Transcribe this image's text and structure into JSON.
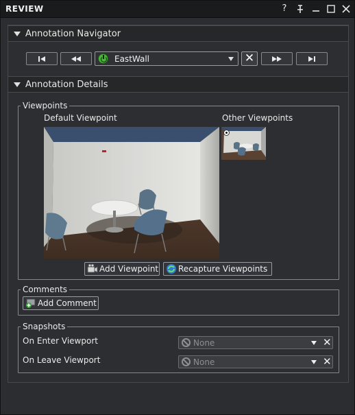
{
  "window": {
    "title": "REVIEW",
    "controls": {
      "help": "?",
      "pin": "†",
      "minimize": "—",
      "maximize": "□",
      "close": "✕"
    }
  },
  "navigator": {
    "section_label": "Annotation Navigator",
    "first_glyph": "▏◀",
    "prev_glyph": "◀◀",
    "next_glyph": "▶▶",
    "last_glyph": "▶▕",
    "annotation_selected": "EastWall",
    "delete_glyph": "✕"
  },
  "details": {
    "section_label": "Annotation Details",
    "viewpoints": {
      "group_title": "Viewpoints",
      "default_label": "Default Viewpoint",
      "other_label": "Other Viewpoints",
      "add_button": "Add Viewpoint",
      "recapture_button": "Recapture Viewpoints"
    },
    "comments": {
      "group_title": "Comments",
      "add_button": "Add Comment"
    },
    "snapshots": {
      "group_title": "Snapshots",
      "on_enter_label": "On Enter Viewport",
      "on_enter_value": "None",
      "on_leave_label": "On Leave Viewport",
      "on_leave_value": "None"
    }
  },
  "colors": {
    "background": "#2c2e31",
    "titlebar": "#1a1b1d",
    "power_green": "#49b33a"
  }
}
